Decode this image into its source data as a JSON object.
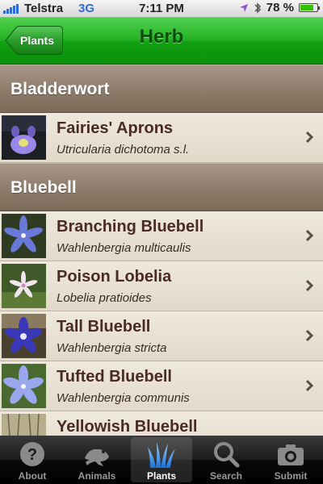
{
  "status_bar": {
    "carrier": "Telstra",
    "network": "3G",
    "time": "7:11 PM",
    "battery": "78 %",
    "battery_level": 0.78
  },
  "nav": {
    "back_label": "Plants",
    "title": "Herb"
  },
  "list": {
    "sections": [
      {
        "title": "Bladderwort",
        "items": [
          {
            "name": "Fairies' Aprons",
            "scientific": "Utricularia dichotoma s.l."
          }
        ]
      },
      {
        "title": "Bluebell",
        "items": [
          {
            "name": "Branching Bluebell",
            "scientific": "Wahlenbergia multicaulis"
          },
          {
            "name": "Poison Lobelia",
            "scientific": "Lobelia pratioides"
          },
          {
            "name": "Tall Bluebell",
            "scientific": "Wahlenbergia stricta"
          },
          {
            "name": "Tufted Bluebell",
            "scientific": "Wahlenbergia communis"
          },
          {
            "name": "Yellowish Bluebell",
            "scientific": ""
          }
        ]
      }
    ]
  },
  "tabbar": {
    "tabs": [
      {
        "label": "About",
        "icon": "question-icon"
      },
      {
        "label": "Animals",
        "icon": "frog-icon"
      },
      {
        "label": "Plants",
        "icon": "grass-icon",
        "active": true
      },
      {
        "label": "Search",
        "icon": "magnifier-icon"
      },
      {
        "label": "Submit",
        "icon": "camera-icon"
      }
    ]
  },
  "colors": {
    "nav_green": "#1faa1f",
    "title_text": "#0c4d0b",
    "section_brown": "#8d7b6a",
    "row_bg": "#e6dfd2",
    "name_text": "#4a2b23"
  }
}
